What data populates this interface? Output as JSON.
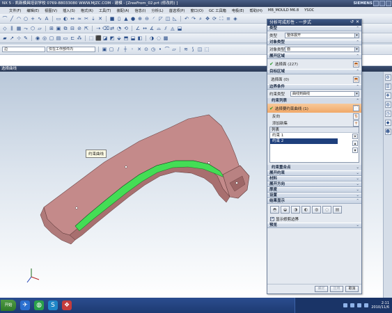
{
  "window": {
    "title": "NX 5 - 凯新模具培训学校  0769-88033080  WWW.MJZC.COM - 建模 - [ZreeFrom_02.prt (修改的) ]",
    "brand": "SIEMENS"
  },
  "menubar": {
    "items": [
      "文件(F)",
      "编辑(E)",
      "视图(V)",
      "插入(S)",
      "格式(R)",
      "工具(T)",
      "装配(A)",
      "信息(I)",
      "分析(L)",
      "首选项(P)",
      "窗口(O)",
      "GC 工具箱",
      "电极(E)",
      "帮助(H)",
      "MB_MOULD M6.8",
      "YSOC"
    ]
  },
  "filter": {
    "type_value": "边",
    "scope_value": "仅在工作部件内"
  },
  "selection_bar": {
    "label": "选择曲线"
  },
  "tooltip": {
    "text": "约束曲线"
  },
  "colors": {
    "part": "#c98c8c",
    "highlight": "#44dd55",
    "dialog_title": "#2a3e64",
    "active_row": "#1e3f7c",
    "hl_row": "#f1a868"
  },
  "dialog": {
    "title": "分析可成形性 - 一步式",
    "sections": {
      "type": {
        "title": "类型",
        "label": "类型",
        "value": "整体展开"
      },
      "object_type": {
        "title": "对象类型",
        "label": "对象类型",
        "value": "面"
      },
      "body_region": {
        "title": "展开区域",
        "select_label": "选择面 (227)"
      },
      "target_region": {
        "title": "目标区域",
        "select_label": "选择面 (0)"
      },
      "boundary": {
        "title": "边界条件",
        "constraint_type_label": "约束类型",
        "constraint_type_value": "曲线到曲线",
        "constraint_list_title": "约束列表",
        "select_curve_label": "选择要约束曲线 (1)",
        "reverse_label": "反向",
        "add_set_label": "添加新集",
        "list_header": "列表",
        "list_items": [
          "约束 1",
          "约束 2"
        ],
        "constraint_points_title": "约束重合点"
      },
      "collapsed": [
        "展开约束",
        "材料",
        "展开方向",
        "厚度",
        "设置",
        "结果显示"
      ],
      "show_boundary_label": "显示修剪边界",
      "preview_title": "预览"
    },
    "buttons": {
      "apply": "确定",
      "ok": "应用",
      "cancel": "取消"
    }
  },
  "taskbar": {
    "start": "开始",
    "time": "2:11",
    "date": "2010/11/6"
  }
}
